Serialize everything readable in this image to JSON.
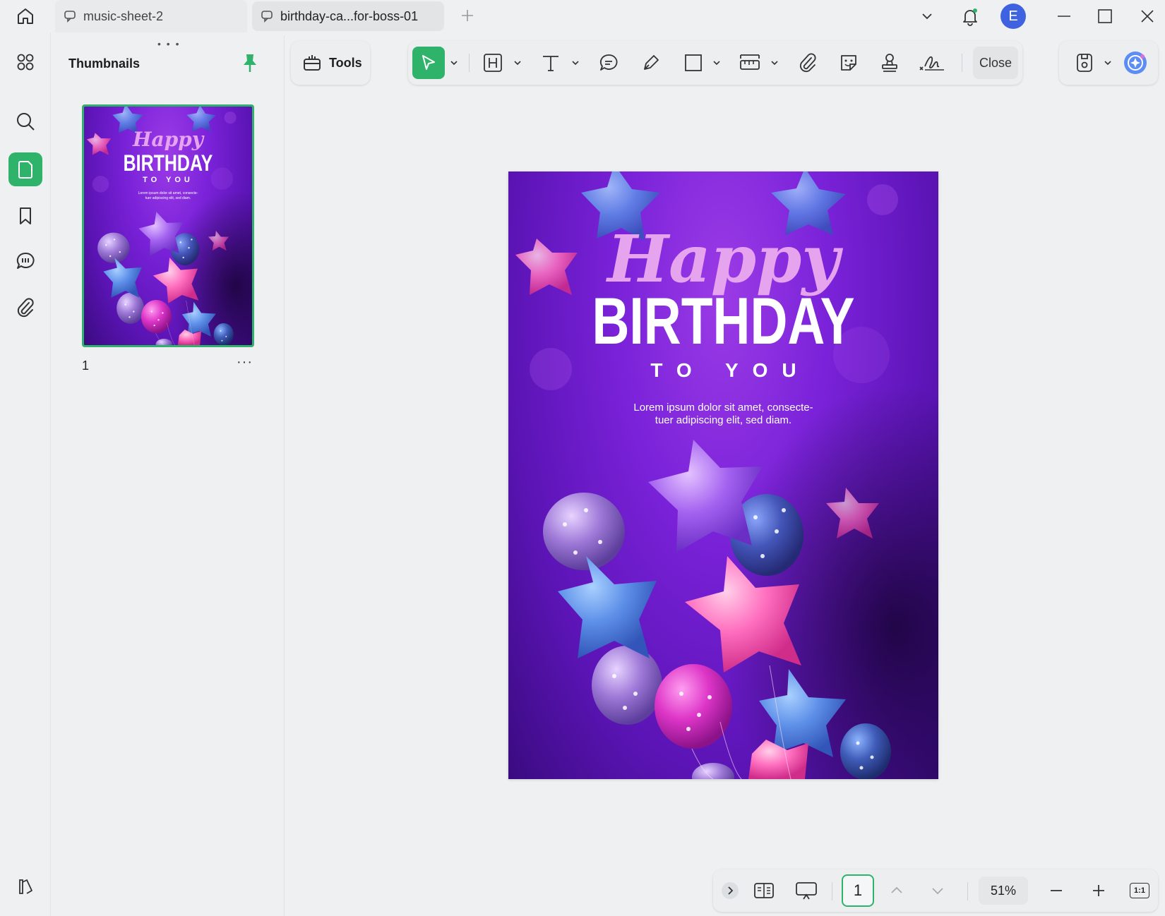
{
  "tabs": [
    {
      "label": "music-sheet-2"
    },
    {
      "label": "birthday-ca...for-boss-01"
    }
  ],
  "user": {
    "initial": "E"
  },
  "panel": {
    "title": "Thumbnails",
    "page_number": "1",
    "more": "···"
  },
  "toolbar": {
    "tools_label": "Tools",
    "close_label": "Close"
  },
  "card": {
    "happy": "Happy",
    "birthday": "BIRTHDAY",
    "to_you": "TO YOU",
    "lorem_line1": "Lorem ipsum dolor sit amet, consecte-",
    "lorem_line2": "tuer adipiscing elit, sed diam."
  },
  "bottom": {
    "page_value": "1",
    "zoom": "51%",
    "actual_size": "1:1"
  },
  "colors": {
    "accent": "#2fb36b",
    "avatar": "#3f63e0",
    "card_purple": "#7a22d9"
  }
}
